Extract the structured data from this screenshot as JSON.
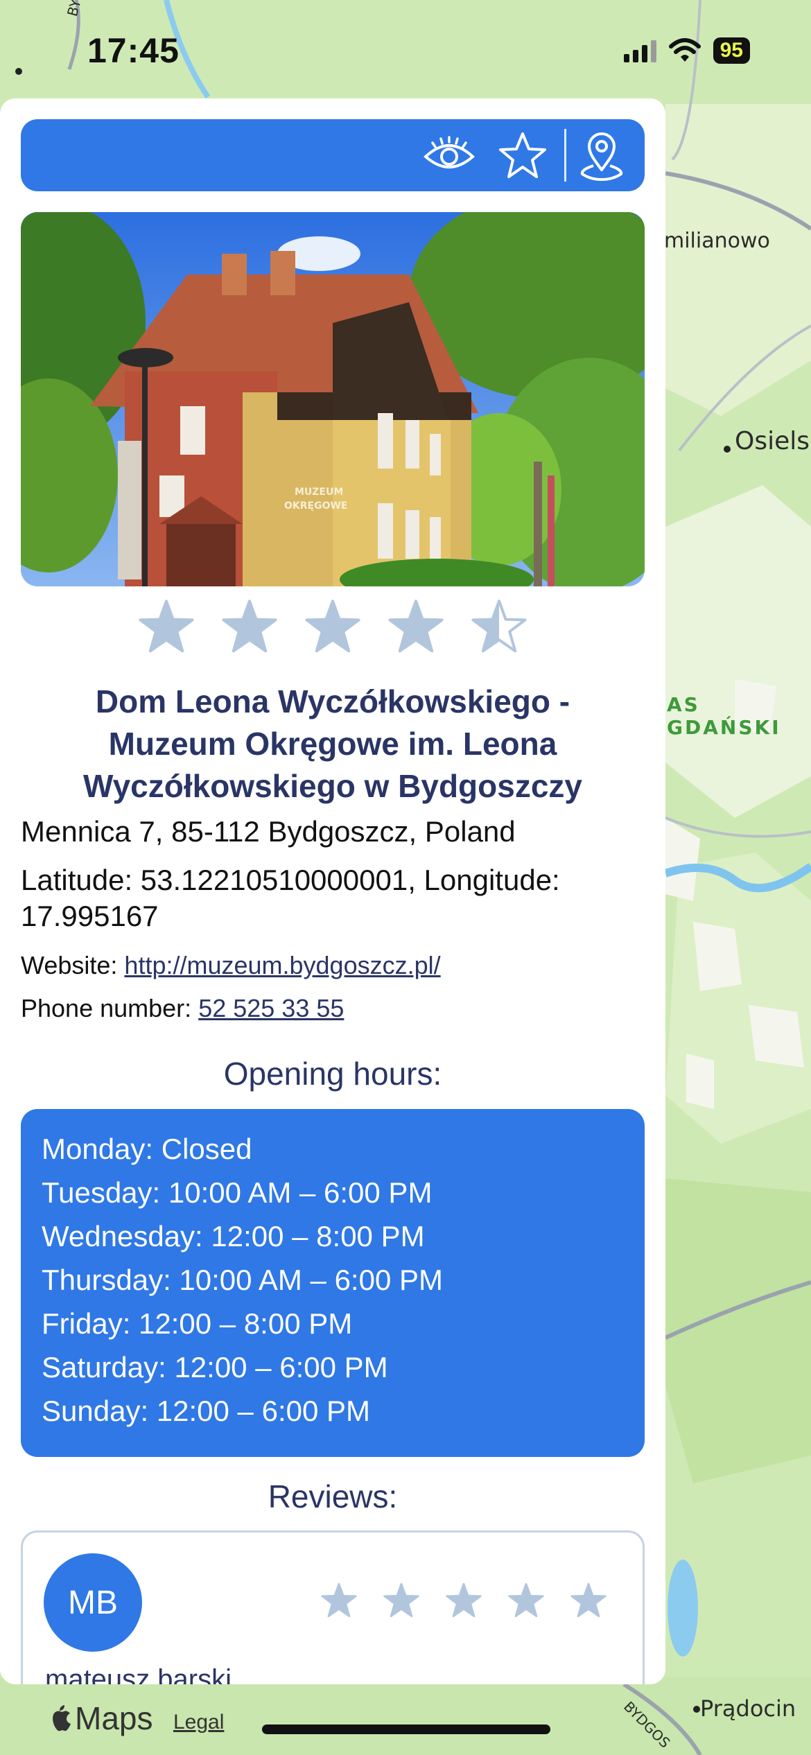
{
  "status_bar": {
    "time": "17:45",
    "battery": "95"
  },
  "toolbar": {
    "icons": [
      "eye-icon",
      "star-outline-icon",
      "map-pin-icon"
    ],
    "accent_color": "#2f78e6"
  },
  "place": {
    "rating_value": 4.5,
    "rating_max": 5,
    "title": "Dom Leona Wyczółkowskiego - Muzeum Okręgowe im. Leona Wyczółkowskiego w Bydgoszczy",
    "address": "Mennica 7, 85-112 Bydgoszcz, Poland",
    "coordinates_line1": "Latitude: 53.12210510000001, Longitude:",
    "coordinates_line2": "17.995167",
    "website_label": "Website:",
    "website_url": "http://muzeum.bydgoszcz.pl/",
    "phone_label": "Phone number:",
    "phone": "52 525 33 55",
    "photo_sign": "MUZEUM OKRĘGOWE"
  },
  "opening_hours": {
    "title": "Opening hours:",
    "days": [
      "Monday: Closed",
      "Tuesday: 10:00 AM – 6:00 PM",
      "Wednesday: 12:00 – 8:00 PM",
      "Thursday: 10:00 AM – 6:00 PM",
      "Friday: 12:00 – 8:00 PM",
      "Saturday: 12:00 – 6:00 PM",
      "Sunday: 12:00 – 6:00 PM"
    ]
  },
  "reviews": {
    "title": "Reviews:",
    "items": [
      {
        "initials": "MB",
        "name": "mateusz barski",
        "stars": 5
      }
    ]
  },
  "map": {
    "labels": [
      "milianowo",
      "Osiels",
      "AS GDAŃSKI",
      "Prądocin",
      "BYDGO",
      "BYDGOS"
    ],
    "logo": "Maps",
    "legal": "Legal"
  }
}
